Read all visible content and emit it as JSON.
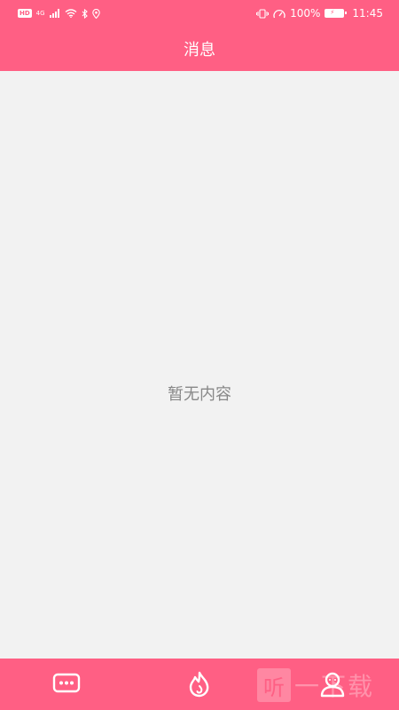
{
  "status_bar": {
    "hd": "HD",
    "network": "4G",
    "battery_percent": "100%",
    "time": "11:45"
  },
  "header": {
    "title": "消息"
  },
  "main": {
    "empty_text": "暂无内容"
  },
  "tabbar": {
    "tabs": [
      {
        "icon": "chat-bubble-icon"
      },
      {
        "icon": "flame-icon"
      },
      {
        "icon": "user-icon"
      }
    ]
  },
  "watermark": {
    "glyph": "听",
    "text": "一下载"
  },
  "colors": {
    "brand": "#ff5f84",
    "background": "#f2f2f2",
    "empty_text": "#888888"
  }
}
